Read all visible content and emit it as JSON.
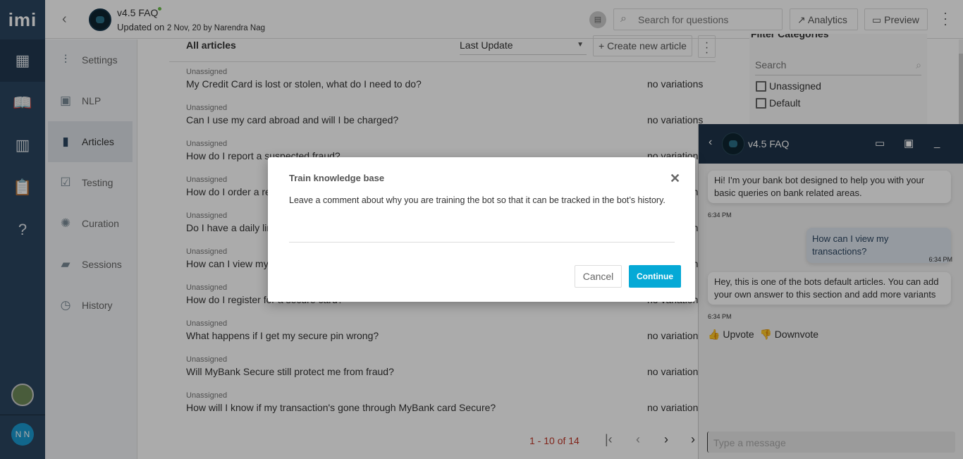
{
  "rail": {
    "logo": "imi",
    "user_initials": "N N"
  },
  "header": {
    "title": "v4.5 FAQ",
    "updated_prefix": "Updated on",
    "updated_detail": "2 Nov, 20 by Narendra Nag",
    "search_placeholder": "Search for questions",
    "analytics": "Analytics",
    "preview": "Preview"
  },
  "subnav": [
    {
      "label": "Settings",
      "icon": "sliders-icon"
    },
    {
      "label": "NLP",
      "icon": "chip-icon"
    },
    {
      "label": "Articles",
      "icon": "document-icon"
    },
    {
      "label": "Testing",
      "icon": "clipboard-check-icon"
    },
    {
      "label": "Curation",
      "icon": "lightbulb-icon"
    },
    {
      "label": "Sessions",
      "icon": "chat-icon"
    },
    {
      "label": "History",
      "icon": "history-icon"
    }
  ],
  "list": {
    "title": "All articles",
    "sort": "Last Update",
    "create": "+ Create new article",
    "rows": [
      {
        "cat": "Unassigned",
        "q": "My Credit Card is lost or stolen, what do I need to do?",
        "v": "no variations"
      },
      {
        "cat": "Unassigned",
        "q": "Can I use my card abroad and will I be charged?",
        "v": "no variations"
      },
      {
        "cat": "Unassigned",
        "q": "How do I report a suspected fraud?",
        "v": "no variations"
      },
      {
        "cat": "Unassigned",
        "q": "How do I order a rep",
        "v": "no variations"
      },
      {
        "cat": "Unassigned",
        "q": "Do I have a daily lim",
        "v": "no variations"
      },
      {
        "cat": "Unassigned",
        "q": "How can I view my t",
        "v": "no variations"
      },
      {
        "cat": "Unassigned",
        "q": "How do I register for a secure card?",
        "v": "no variations"
      },
      {
        "cat": "Unassigned",
        "q": "What happens if I get my secure pin wrong?",
        "v": "no variations"
      },
      {
        "cat": "Unassigned",
        "q": "Will MyBank Secure still protect me from fraud?",
        "v": "no variations"
      },
      {
        "cat": "Unassigned",
        "q": "How will I know if my transaction's gone through MyBank card Secure?",
        "v": "no variations"
      }
    ],
    "pagination": "1 - 10 of 14"
  },
  "filter": {
    "title": "Filter Categories",
    "search_placeholder": "Search",
    "options": [
      "Unassigned",
      "Default"
    ]
  },
  "chat": {
    "title": "v4.5 FAQ",
    "messages": [
      {
        "text": "Hi! I'm your bank bot designed to help you with your basic queries on bank related areas.",
        "time": "6:34 PM"
      },
      {
        "text": "How can I view my transactions?",
        "time": "6:34 PM"
      },
      {
        "text": "Hey, this is one of the bots default articles. You can add your own answer to this section and add more variants",
        "time": "6:34 PM"
      }
    ],
    "upvote": "Upvote",
    "downvote": "Downvote",
    "input_placeholder": "Type a message"
  },
  "modal": {
    "title": "Train knowledge base",
    "description": "Leave a comment about why you are training the bot so that it can be tracked in the bot’s history.",
    "comment_value": "",
    "cancel": "Cancel",
    "continue": "Continue"
  },
  "colors": {
    "rail": "#2b4560",
    "chat_header": "#1f3349",
    "primary": "#05a9d6",
    "pager_range": "#c0392b"
  }
}
